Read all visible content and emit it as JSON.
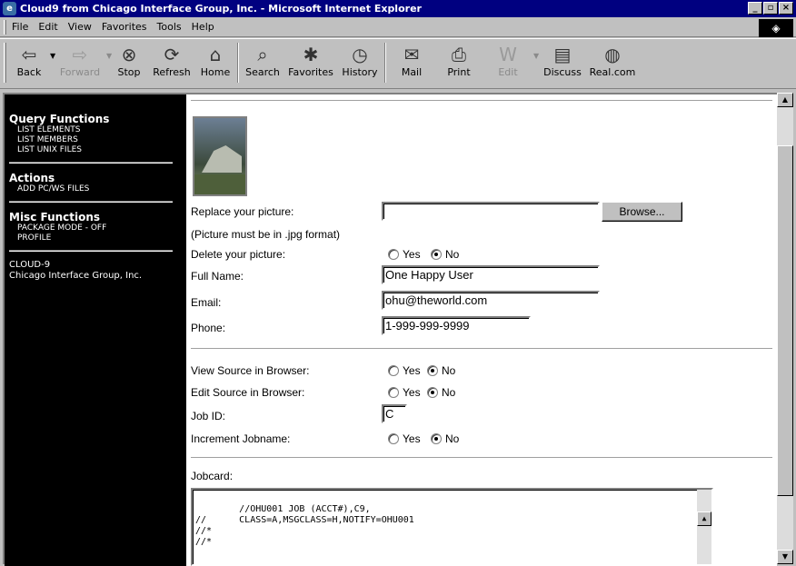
{
  "window": {
    "title": "Cloud9 from Chicago Interface Group, Inc. - Microsoft Internet Explorer",
    "controls": [
      "_",
      "▫",
      "×"
    ]
  },
  "menubar": {
    "items": [
      "File",
      "Edit",
      "View",
      "Favorites",
      "Tools",
      "Help"
    ]
  },
  "toolbar": {
    "buttons": [
      {
        "label": "Back",
        "icon": "back-arrow-icon",
        "glyph": "⇦"
      },
      {
        "label": "Forward",
        "icon": "forward-arrow-icon",
        "glyph": "⇨"
      },
      {
        "label": "Stop",
        "icon": "stop-icon",
        "glyph": "⊗"
      },
      {
        "label": "Refresh",
        "icon": "refresh-icon",
        "glyph": "⟳"
      },
      {
        "label": "Home",
        "icon": "home-icon",
        "glyph": "⌂"
      },
      {
        "label": "Search",
        "icon": "search-icon",
        "glyph": "⌕"
      },
      {
        "label": "Favorites",
        "icon": "favorites-icon",
        "glyph": "✱"
      },
      {
        "label": "History",
        "icon": "history-icon",
        "glyph": "◷"
      },
      {
        "label": "Mail",
        "icon": "mail-icon",
        "glyph": "✉"
      },
      {
        "label": "Print",
        "icon": "print-icon",
        "glyph": "⎙"
      },
      {
        "label": "Edit",
        "icon": "edit-icon",
        "glyph": "W"
      },
      {
        "label": "Discuss",
        "icon": "discuss-icon",
        "glyph": "▤"
      },
      {
        "label": "Real.com",
        "icon": "realcom-icon",
        "glyph": "◍"
      }
    ]
  },
  "sidebar": {
    "sections": [
      {
        "heading": "Query Functions",
        "items": [
          "LIST ELEMENTS",
          "LIST MEMBERS",
          "LIST UNIX FILES"
        ]
      },
      {
        "heading": "Actions",
        "items": [
          "ADD PC/WS FILES"
        ]
      },
      {
        "heading": "Misc Functions",
        "items": [
          "PACKAGE MODE - OFF",
          "PROFILE"
        ]
      }
    ],
    "footer": [
      "CLOUD-9",
      "Chicago Interface Group, Inc."
    ]
  },
  "form": {
    "replace_picture_label": "Replace your picture:",
    "picture_format_note": "(Picture must be in .jpg format)",
    "browse_label": "Browse...",
    "replace_picture_value": "",
    "delete_picture_label": "Delete your picture:",
    "full_name_label": "Full Name:",
    "full_name_value": "One Happy User",
    "email_label": "Email:",
    "email_value": "ohu@theworld.com",
    "phone_label": "Phone:",
    "phone_value": "1-999-999-9999",
    "view_source_label": "View Source in Browser:",
    "edit_source_label": "Edit Source in Browser:",
    "job_id_label": "Job ID:",
    "job_id_value": "C",
    "increment_jobname_label": "Increment Jobname:",
    "jobcard_label": "Jobcard:",
    "jobcard_value": "//OHU001 JOB (ACCT#),C9,\n//      CLASS=A,MSGCLASS=H,NOTIFY=OHU001\n//*\n//*",
    "yes_label": "Yes",
    "no_label": "No"
  },
  "radios": {
    "delete_picture": "No",
    "view_source": "No",
    "edit_source": "No",
    "increment_jobname": "No"
  }
}
